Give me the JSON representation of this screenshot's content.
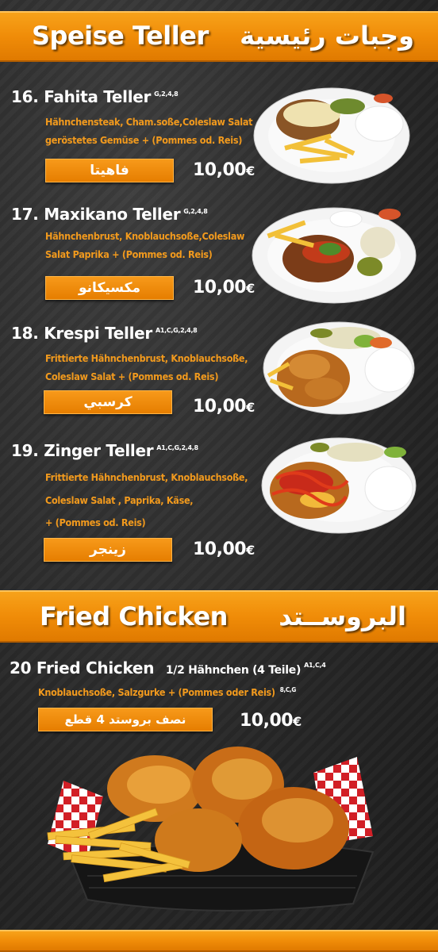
{
  "sections": {
    "speise": {
      "title": "Speise Teller",
      "title_ar": "وجبات رئيسية"
    },
    "fried": {
      "title": "Fried Chicken",
      "title_ar": "البروســتد"
    }
  },
  "items": [
    {
      "title": "16. Fahita Teller",
      "allergens": "G,2,4,8",
      "desc_1": "Hähnchensteak, Cham.soße,Coleslaw Salat",
      "desc_2": "geröstetes Gemüse + (Pommes od. Reis)",
      "name_ar": "فاهيتا",
      "price": "10,00",
      "currency": "€"
    },
    {
      "title": "17. Maxikano Teller",
      "allergens": "G,2,4,8",
      "desc_1": "Hähnchenbrust, Knoblauchsoße,Coleslaw",
      "desc_2": "Salat Paprika  + (Pommes od. Reis)",
      "name_ar": "مكسيكانو",
      "price": "10,00",
      "currency": "€"
    },
    {
      "title": "18. Krespi Teller",
      "allergens": "A1,C,G,2,4,8",
      "desc_1": "Frittierte Hähnchenbrust, Knoblauchsoße,",
      "desc_2": "Coleslaw Salat  + (Pommes od. Reis)",
      "name_ar": "كرسبي",
      "price": "10,00",
      "currency": "€"
    },
    {
      "title": "19. Zinger Teller",
      "allergens": "A1,C,G,2,4,8",
      "desc_1": "Frittierte Hähnchenbrust, Knoblauchsoße,",
      "desc_2": "Coleslaw Salat , Paprika, Käse,",
      "desc_3": "+ (Pommes od. Reis)",
      "name_ar": "زينجر",
      "price": "10,00",
      "currency": "€"
    }
  ],
  "fried_item": {
    "title": "20 Fried Chicken",
    "subtitle": "1/2 Hähnchen (4 Teile)",
    "allergens_1": "A1,C,4",
    "desc": "Knoblauchsoße, Salzgurke  + (Pommes oder Reis)",
    "allergens_2": "8,C,G",
    "name_ar": "نصف بروستد 4 قطع",
    "price": "10,00",
    "currency": "€"
  },
  "colors": {
    "accent_orange": "#f08c08",
    "description_orange": "#f29a1d",
    "background_dark": "#2b2b2b",
    "text_white": "#ffffff"
  }
}
